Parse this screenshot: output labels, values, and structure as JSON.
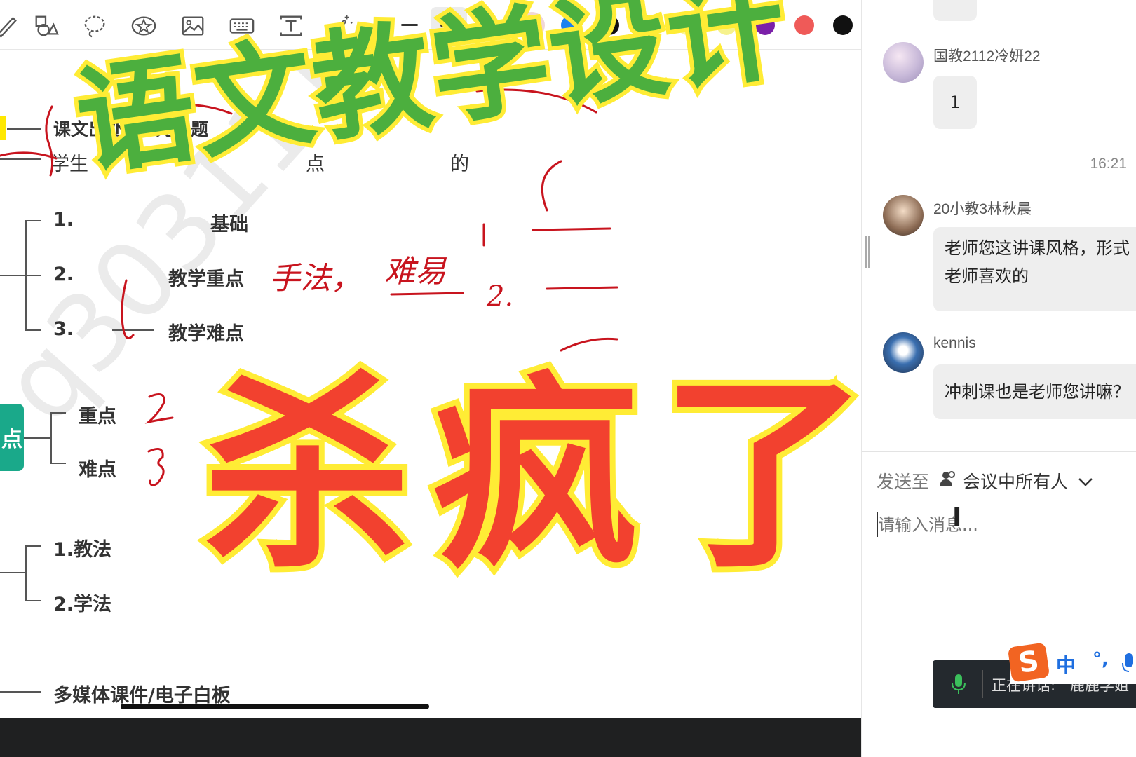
{
  "toolbar": {
    "tools": [
      "pen-icon",
      "shapes-icon",
      "lasso-icon",
      "sticker-icon",
      "image-icon",
      "keyboard-icon",
      "text-icon",
      "magic-wand-icon"
    ],
    "colors": [
      "#cc1a1a",
      "#1a82ef",
      "#111111",
      "#11785a",
      "#fbf59a",
      "#f6f28d",
      "#7a1fa8",
      "#ef5a58",
      "#111111"
    ],
    "selected_color": "#cc1a1a"
  },
  "mindmap": {
    "row1": "课文出处+单元主题",
    "row2_prefix": "学生",
    "row2_mid": "点",
    "row2_end": "的",
    "items_top": [
      "1.",
      "2.",
      "3."
    ],
    "sub_basic": "基础",
    "sub_focus": "教学重点",
    "sub_difficult": "教学难点",
    "green_node": "点",
    "focus": "重点",
    "difficult": "难点",
    "methods": [
      "1.教法",
      "2.学法"
    ],
    "media": "多媒体课件/电子白板"
  },
  "annotations": {
    "handwriting1": "手法，",
    "handwriting2": "难易",
    "num2": "2.",
    "num3": "3"
  },
  "watermark": "q3031117",
  "overlay": {
    "title_top": "语文教学设计",
    "title_bottom": "杀疯了"
  },
  "chat": {
    "messages": [
      {
        "sender": "国教2112冷妍22",
        "text": "1"
      },
      {
        "sender": "20小教3林秋晨",
        "text": "老师您这讲课风格，形式\n老师喜欢的"
      },
      {
        "sender": "kennis",
        "text": "冲刺课也是老师您讲嘛？"
      }
    ],
    "time": "16:21",
    "send_to_label": "发送至",
    "send_to_target": "会议中所有人",
    "input_placeholder": "请输入消息...",
    "speaking_label": "正在讲话:",
    "speaking_name": "鹿鹿学姐",
    "ime_mode": "中",
    "ime_punct": "°,"
  }
}
